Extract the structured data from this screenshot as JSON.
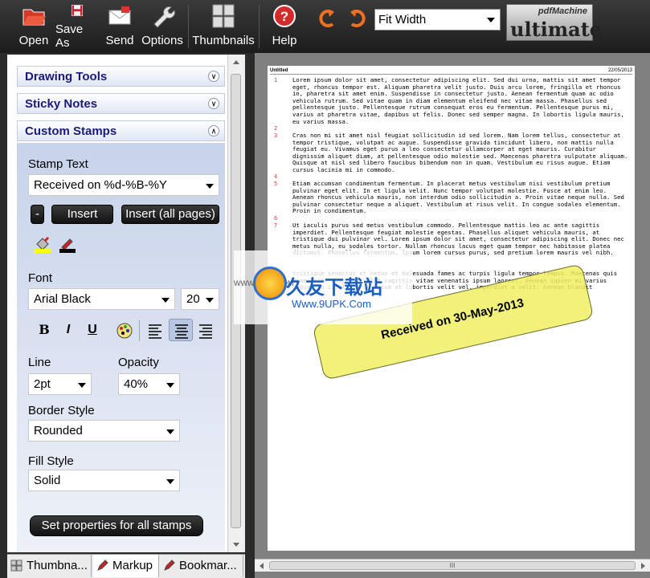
{
  "toolbar": {
    "buttons": [
      {
        "label": "Open",
        "icon": "folder-open-icon"
      },
      {
        "label": "Save As",
        "icon": "save-icon"
      },
      {
        "label": "Send",
        "icon": "mail-icon"
      },
      {
        "label": "Options",
        "icon": "wrench-icon"
      },
      {
        "label": "Thumbnails",
        "icon": "thumbnails-icon"
      },
      {
        "label": "Help",
        "icon": "help-icon"
      }
    ],
    "zoom": "Fit Width",
    "logo_top": "pdfMachine",
    "logo_main": "ultimate"
  },
  "sections": {
    "drawing_tools": "Drawing Tools",
    "sticky_notes": "Sticky Notes",
    "custom_stamps": "Custom Stamps"
  },
  "stamp_panel": {
    "stamp_text_label": "Stamp Text",
    "stamp_text_value": "Received on %d-%B-%Y",
    "minus_label": "-",
    "insert_label": "Insert",
    "insert_all_label": "Insert (all pages)",
    "font_label": "Font",
    "font_value": "Arial Black",
    "font_size": "20",
    "bold": "B",
    "italic": "I",
    "underline": "U",
    "line_label": "Line",
    "line_value": "2pt",
    "opacity_label": "Opacity",
    "opacity_value": "40%",
    "border_label": "Border Style",
    "border_value": "Rounded",
    "fill_label": "Fill Style",
    "fill_value": "Solid",
    "set_all_label": "Set properties for all stamps"
  },
  "tabs": [
    "Thumbna...",
    "Markup",
    "Bookmar..."
  ],
  "document": {
    "header_left": "Untitled",
    "header_right": "22/05/2013",
    "paragraphs": [
      {
        "num": "1",
        "text": "Lorem ipsum dolor sit amet, consectetur adipiscing elit. Sed dui urna, mattis sit amet tempor eget, rhoncus tempor est. Aliquam pharetra velit justo. Duis arcu lorem, fringilla et rhoncus in, pharetra sit amet enim. Suspendisse in consectetur justo. Aenean fermentum quam ac odio vehicula rutrum. Sed vitae quam in diam elementum eleifend nec vitae massa. Phasellus sed pellentesque justo. Pellentesque rutrum consequat eros eu fermentum. Pellentesque purus mi, varius at pharetra vitae, dapibus ut felis. Donec sed semper magna. In lobortis ligula mauris, eu varius massa."
      },
      {
        "num": "2",
        "text": ""
      },
      {
        "num": "3",
        "text": "Cras non mi sit amet nisl feugiat sollicitudin id sed lorem. Nam lorem tellus, consectetur at tempor tristique, volutpat ac augue. Suspendisse gravida tincidunt libero, non mattis nulla feugiat eu. Vivamus eget purus a leo consectetur ullamcorper at eget mauris. Curabitur dignissim aliquet diam, at pellentesque odio molestie sed. Maecenas pharetra vulputate aliquam. Quisque at nisl sed libero faucibus bibendum non in quam. Vestibulum eu risus augue. Etiam cursus lacinia mi in commodo."
      },
      {
        "num": "4",
        "text": ""
      },
      {
        "num": "5",
        "text": "Etiam accumsan condimentum fermentum. In placerat metus vestibulum nisi vestibulum pretium pulvinar eget elit. In et ligula velit. Nunc tempor volutpat molestie. Fusce at enim leo. Aenean rhoncus vehicula mauris, non interdum odio sollicitudin a. Proin vitae neque nulla. Sed pulvinar consectetur neque a aliquet. Vestibulum at risus velit. In congue sodales elementum. Proin in condimentum."
      },
      {
        "num": "6",
        "text": ""
      },
      {
        "num": "7",
        "text": "Ut iaculis purus sed metus vestibulum commodo. Pellentesque mattis leo ac ante sagittis imperdiet. Pellentesque feugiat molestie egestas. Phasellus aliquet vehicula mauris, at tristique dui pulvinar vel. Lorem ipsum dolor sit amet, consectetur adipiscing elit. Donec nec metus nulla, eu sodales tortor. Nullam rhoncus lacus eget quam tempor nec habitasse platea dictumst. Phasellus fermentum, ipsum lorem cursus purus, sed pretium lorem mauris vel nibh."
      },
      {
        "num": "",
        "text": "tristique senectus et netus et malesuada fames ac turpis ligula tempor tempus. Maecenas quis diam enim. Fusce at velit sagittis vitae venenatis ipsum laoreet. Aenean sapien mi varius augue, in iaculis arcu ipsum at lobortis velit vel. imperdiet a velit. Aenean blandit"
      }
    ],
    "stamp_text": "Received on 30-May-2013"
  },
  "watermark": {
    "cn": "久友下载站",
    "url": "Www.9UPK.Com",
    "small": "WWW.9UPK.COM"
  },
  "hscroll_label": "III"
}
